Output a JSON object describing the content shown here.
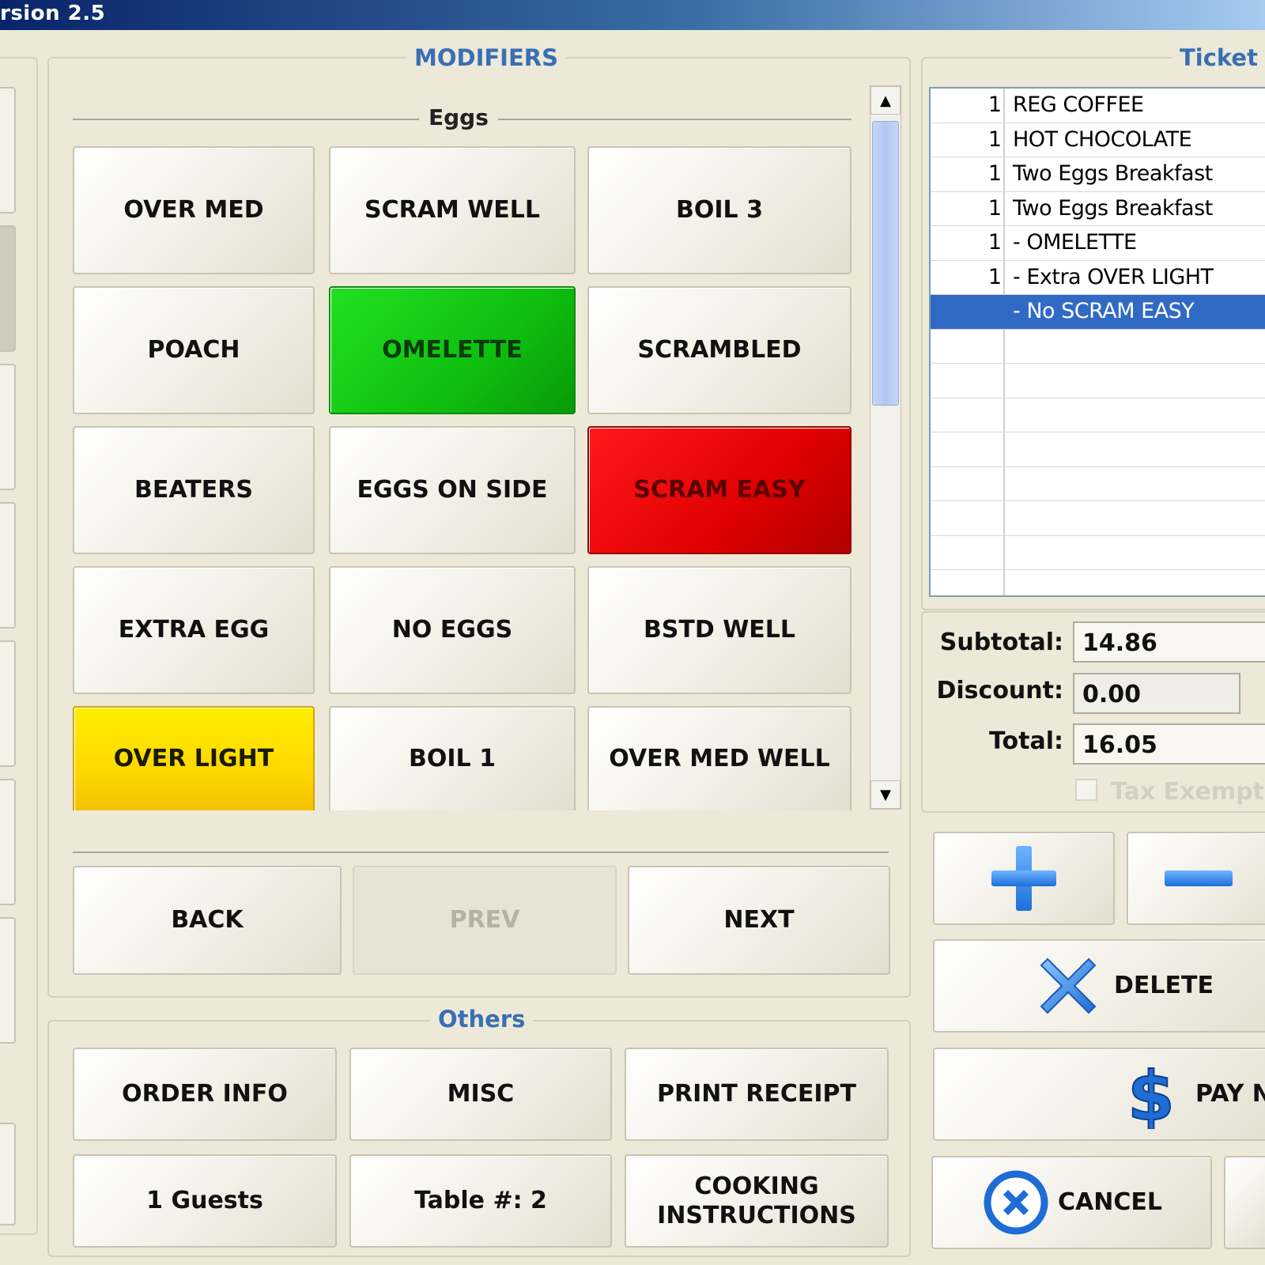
{
  "window": {
    "title": "rsion 2.5"
  },
  "modifiers": {
    "legend": "MODIFIERS",
    "group_label": "Eggs",
    "buttons": [
      {
        "label": "OVER MED"
      },
      {
        "label": "SCRAM WELL"
      },
      {
        "label": "BOIL 3"
      },
      {
        "label": "POACH"
      },
      {
        "label": "OMELETTE"
      },
      {
        "label": "SCRAMBLED"
      },
      {
        "label": "BEATERS"
      },
      {
        "label": "EGGS ON SIDE"
      },
      {
        "label": "SCRAM EASY"
      },
      {
        "label": "EXTRA EGG"
      },
      {
        "label": "NO EGGS"
      },
      {
        "label": "BSTD WELL"
      },
      {
        "label": "OVER LIGHT"
      },
      {
        "label": "BOIL 1"
      },
      {
        "label": "OVER MED WELL"
      }
    ],
    "states": {
      "omelette": "selected (green)",
      "scram_easy": "excluded (red)",
      "over_light": "extra (yellow)"
    },
    "colors": {
      "green": "#10c010",
      "red": "#e00000",
      "yellow": "#ffd800"
    },
    "nav": {
      "back": "BACK",
      "prev": "PREV",
      "next": "NEXT",
      "prev_enabled": false
    }
  },
  "others": {
    "legend": "Others",
    "order_info": "ORDER INFO",
    "misc": "MISC",
    "print_receipt": "PRINT RECEIPT",
    "guests": "1 Guests",
    "table": "Table #: 2",
    "cooking_line1": "COOKING",
    "cooking_line2": "INSTRUCTIONS"
  },
  "ticket": {
    "legend": "Ticket",
    "rows": [
      {
        "qty": "1",
        "item": "REG COFFEE"
      },
      {
        "qty": "1",
        "item": "HOT CHOCOLATE"
      },
      {
        "qty": "1",
        "item": "Two Eggs Breakfast"
      },
      {
        "qty": "1",
        "item": "Two Eggs Breakfast"
      },
      {
        "qty": "1",
        "item": " - OMELETTE"
      },
      {
        "qty": "1",
        "item": " - Extra OVER LIGHT"
      },
      {
        "qty": "",
        "item": " - No SCRAM EASY",
        "selected": true
      }
    ],
    "selection_color": "#316ac5"
  },
  "totals": {
    "subtotal_label": "Subtotal:",
    "subtotal": "14.86",
    "discount_label": "Discount:",
    "discount": "0.00",
    "total_label": "Total:",
    "total": "16.05",
    "tax_exempt_label": "Tax Exempt",
    "tax_exempt_checked": false
  },
  "actions": {
    "plus_icon": "plus-icon",
    "minus_icon": "minus-icon",
    "delete": "DELETE",
    "pay": "PAY N",
    "cancel": "CANCEL"
  }
}
